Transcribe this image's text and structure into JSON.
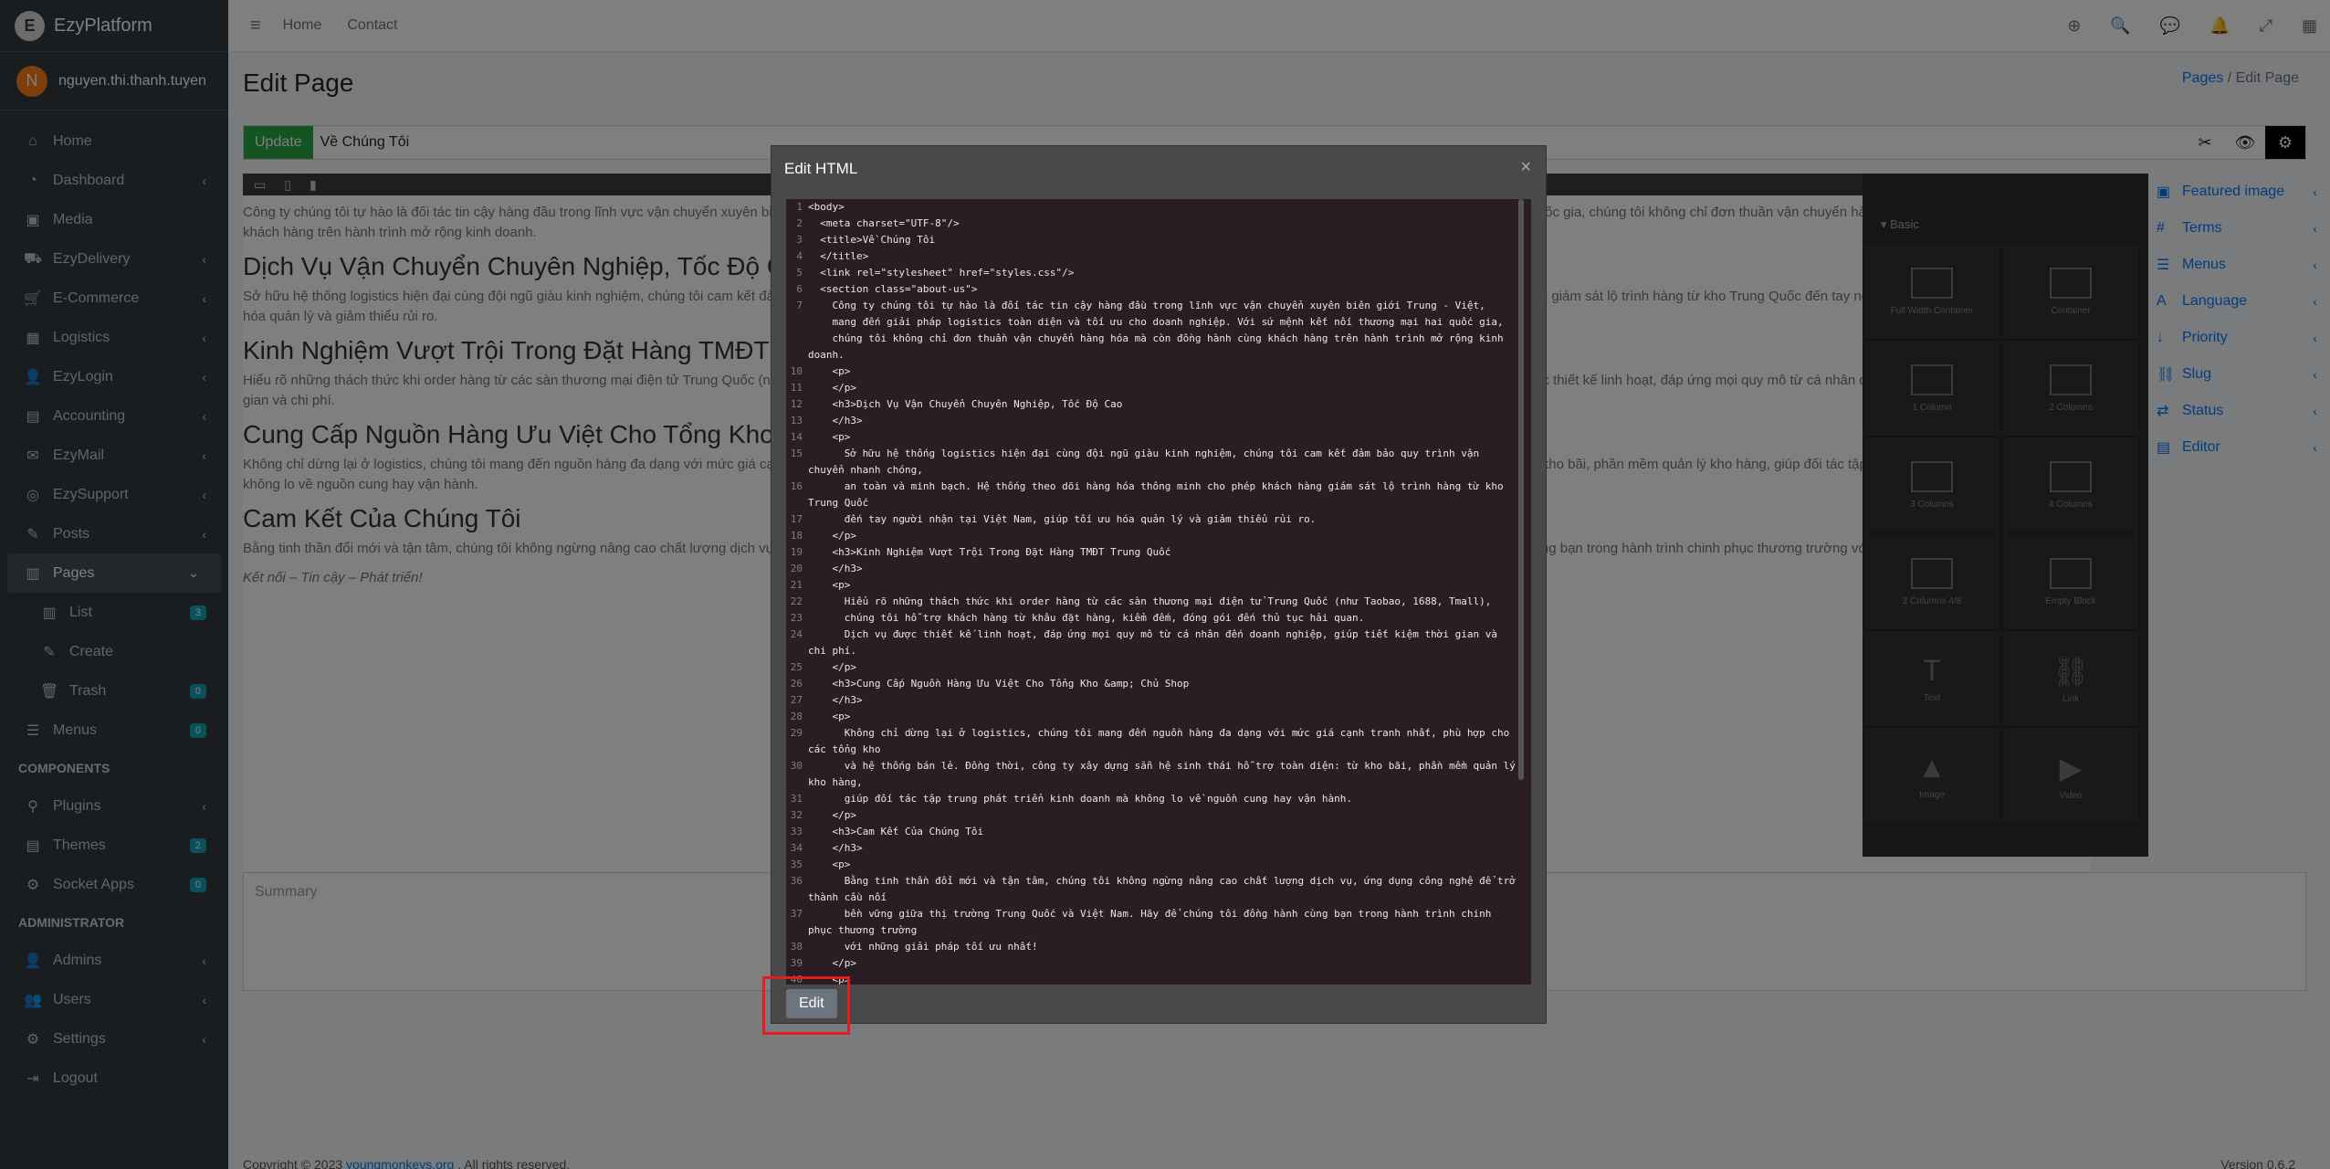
{
  "app": {
    "brand": "EzyPlatform",
    "brand_logo_letter": "E",
    "user_initial": "N",
    "user_name": "nguyen.thi.thanh.tuyen"
  },
  "sidebar": {
    "items": [
      {
        "label": "Home",
        "icon": "home-icon",
        "glyph": "⌂"
      },
      {
        "label": "Dashboard",
        "icon": "dashboard-icon",
        "glyph": "◔",
        "chev": "‹"
      },
      {
        "label": "Media",
        "icon": "media-icon",
        "glyph": "▣"
      },
      {
        "label": "EzyDelivery",
        "icon": "truck-icon",
        "glyph": "⛟",
        "chev": "‹"
      },
      {
        "label": "E-Commerce",
        "icon": "cart-icon",
        "glyph": "🛒",
        "chev": "‹"
      },
      {
        "label": "Logistics",
        "icon": "logistics-icon",
        "glyph": "▦",
        "chev": "‹"
      },
      {
        "label": "EzyLogin",
        "icon": "login-icon",
        "glyph": "👤",
        "chev": "‹"
      },
      {
        "label": "Accounting",
        "icon": "accounting-icon",
        "glyph": "▤",
        "chev": "‹"
      },
      {
        "label": "EzyMail",
        "icon": "mail-icon",
        "glyph": "✉",
        "chev": "‹"
      },
      {
        "label": "EzySupport",
        "icon": "support-icon",
        "glyph": "◎",
        "chev": "‹"
      },
      {
        "label": "Posts",
        "icon": "posts-icon",
        "glyph": "✎",
        "chev": "‹"
      },
      {
        "label": "Pages",
        "icon": "pages-icon",
        "glyph": "▥",
        "chev": "⌄"
      },
      {
        "label": "List",
        "icon": "list-icon",
        "glyph": "▥",
        "badge": "3"
      },
      {
        "label": "Create",
        "icon": "create-icon",
        "glyph": "✎"
      },
      {
        "label": "Trash",
        "icon": "trash-icon",
        "glyph": "🗑",
        "badge": "0"
      },
      {
        "label": "Menus",
        "icon": "menus-icon",
        "glyph": "☰",
        "badge": "0"
      }
    ],
    "components_header": "COMPONENTS",
    "components": [
      {
        "label": "Plugins",
        "icon": "plugins-icon",
        "glyph": "⚲",
        "chev": "‹"
      },
      {
        "label": "Themes",
        "icon": "themes-icon",
        "glyph": "▤",
        "badge": "2"
      },
      {
        "label": "Socket Apps",
        "icon": "socket-icon",
        "glyph": "⚙",
        "badge": "0"
      }
    ],
    "admin_header": "ADMINISTRATOR",
    "admin": [
      {
        "label": "Admins",
        "icon": "admins-icon",
        "glyph": "👤",
        "chev": "‹"
      },
      {
        "label": "Users",
        "icon": "users-icon",
        "glyph": "👥",
        "chev": "‹"
      },
      {
        "label": "Settings",
        "icon": "settings-icon",
        "glyph": "⚙",
        "chev": "‹"
      },
      {
        "label": "Logout",
        "icon": "logout-icon",
        "glyph": "⇥"
      }
    ]
  },
  "topbar": {
    "burger": "≡",
    "home": "Home",
    "contact": "Contact",
    "icons": [
      "⊕",
      "🔍",
      "💬",
      "🔔",
      "⤢",
      "▦"
    ]
  },
  "page": {
    "title": "Edit Page",
    "breadcrumb_pages": "Pages",
    "breadcrumb_sep": "/",
    "breadcrumb_current": "Edit Page",
    "update_label": "Update",
    "page_title_value": "Về Chúng Tôi",
    "summary_placeholder": "Summary",
    "footer_prefix": "Copyright © 2023",
    "footer_link": "youngmonkeys.org",
    "footer_suffix": ". All rights reserved.",
    "version": "Version 0.6.2"
  },
  "canvas": {
    "p1": "Công ty chúng tôi tự hào là đối tác tin cậy hàng đầu trong lĩnh vực vận chuyển xuyên biên giới Trung - Việt, mang đến giải pháp logistics toàn diện và tối ưu cho doanh nghiệp. Với sứ mệnh kết nối thương mại hai quốc gia, chúng tôi không chỉ đơn thuần vận chuyển hàng hóa mà còn đồng hành cùng khách hàng trên hành trình mở rộng kinh doanh.",
    "h1": "Dịch Vụ Vận Chuyển Chuyên Nghiệp, Tốc Độ Cao",
    "p2": "Sở hữu hệ thống logistics hiện đại cùng đội ngũ giàu kinh nghiệm, chúng tôi cam kết đảm bảo quy trình vận chuyển nhanh chóng, an toàn và minh bạch. Hệ thống theo dõi hàng hóa thông minh cho phép khách hàng giám sát lộ trình hàng từ kho Trung Quốc đến tay người nhận tại Việt Nam, giúp tối ưu hóa quản lý và giảm thiểu rủi ro.",
    "h2": "Kinh Nghiệm Vượt Trội Trong Đặt Hàng TMĐT Trung Quốc",
    "p3": "Hiểu rõ những thách thức khi order hàng từ các sàn thương mại điện tử Trung Quốc (như Taobao, 1688, Tmall), chúng tôi hỗ trợ khách hàng từ khâu đặt hàng, kiểm đếm, đóng gói đến thủ tục hải quan. Dịch vụ được thiết kế linh hoạt, đáp ứng mọi quy mô từ cá nhân đến doanh nghiệp, giúp tiết kiệm thời gian và chi phí.",
    "h3": "Cung Cấp Nguồn Hàng Ưu Việt Cho Tổng Kho & Chủ Shop",
    "p4": "Không chỉ dừng lại ở logistics, chúng tôi mang đến nguồn hàng đa dạng với mức giá cạnh tranh nhất, phù hợp cho các tổng kho và hệ thống bán lẻ. Đồng thời, công ty xây dựng sẵn hệ sinh thái hỗ trợ toàn diện: từ kho bãi, phần mềm quản lý kho hàng, giúp đối tác tập trung phát triển kinh doanh mà không lo về nguồn cung hay vận hành.",
    "h4": "Cam Kết Của Chúng Tôi",
    "p5": "Bằng tinh thần đổi mới và tận tâm, chúng tôi không ngừng nâng cao chất lượng dịch vụ, ứng dụng công nghệ để trở thành cầu nối bền vững giữa thị trường Trung Quốc và Việt Nam. Hãy để chúng tôi đồng hành cùng bạn trong hành trình chinh phục thương trường với những giải pháp tối ưu nhất!",
    "tagline": "Kết nối – Tin cậy – Phát triển!"
  },
  "blocks": {
    "section": "Basic",
    "items": [
      {
        "label": "Full Width Container",
        "kind": "box"
      },
      {
        "label": "Container",
        "kind": "box"
      },
      {
        "label": "1 Column",
        "kind": "box"
      },
      {
        "label": "2 Columns",
        "kind": "box"
      },
      {
        "label": "3 Columns",
        "kind": "box"
      },
      {
        "label": "4 Columns",
        "kind": "box"
      },
      {
        "label": "2 Columns 4/8",
        "kind": "box"
      },
      {
        "label": "Empty Block",
        "kind": "box"
      },
      {
        "label": "Text",
        "kind": "glyph",
        "glyph": "T"
      },
      {
        "label": "Link",
        "kind": "glyph",
        "glyph": "⛓"
      },
      {
        "label": "Image",
        "kind": "glyph",
        "glyph": "▲"
      },
      {
        "label": "Video",
        "kind": "glyph",
        "glyph": "▶"
      }
    ]
  },
  "props": [
    {
      "label": "Featured image",
      "glyph": "▣"
    },
    {
      "label": "Terms",
      "glyph": "#"
    },
    {
      "label": "Menus",
      "glyph": "☰"
    },
    {
      "label": "Language",
      "glyph": "A"
    },
    {
      "label": "Priority",
      "glyph": "↓"
    },
    {
      "label": "Slug",
      "glyph": "⛓"
    },
    {
      "label": "Status",
      "glyph": "⇄"
    },
    {
      "label": "Editor",
      "glyph": "▤"
    }
  ],
  "modal": {
    "title": "Edit HTML",
    "close": "×",
    "edit_label": "Edit",
    "code_lines": [
      [
        "1",
        "<body>"
      ],
      [
        "2",
        "  <meta charset=\"UTF-8\"/>"
      ],
      [
        "3",
        "  <title>Về Chúng Tôi"
      ],
      [
        "4",
        "  </title>"
      ],
      [
        "5",
        "  <link rel=\"stylesheet\" href=\"styles.css\"/>"
      ],
      [
        "6",
        "  <section class=\"about-us\">"
      ],
      [
        "7",
        "    Công ty chúng tôi tự hào là đối tác tin cậy hàng đầu trong lĩnh vực vận chuyển xuyên biên giới Trung - Việt,\n    mang đến giải pháp logistics toàn diện và tối ưu cho doanh nghiệp. Với sứ mệnh kết nối thương mại hai quốc gia,\n    chúng tôi không chỉ đơn thuần vận chuyển hàng hóa mà còn đồng hành cùng khách hàng trên hành trình mở rộng kinh\ndoanh."
      ],
      [
        "10",
        "    <p>"
      ],
      [
        "11",
        "    </p>"
      ],
      [
        "12",
        "    <h3>Dịch Vụ Vận Chuyển Chuyên Nghiệp, Tốc Độ Cao"
      ],
      [
        "13",
        "    </h3>"
      ],
      [
        "14",
        "    <p>"
      ],
      [
        "15",
        "      Sở hữu hệ thống logistics hiện đại cùng đội ngũ giàu kinh nghiệm, chúng tôi cam kết đảm bảo quy trình vận\nchuyển nhanh chóng,"
      ],
      [
        "16",
        "      an toàn và minh bạch. Hệ thống theo dõi hàng hóa thông minh cho phép khách hàng giám sát lộ trình hàng từ kho\nTrung Quốc"
      ],
      [
        "17",
        "      đến tay người nhận tại Việt Nam, giúp tối ưu hóa quản lý và giảm thiểu rủi ro."
      ],
      [
        "18",
        "    </p>"
      ],
      [
        "19",
        "    <h3>Kinh Nghiệm Vượt Trội Trong Đặt Hàng TMĐT Trung Quốc"
      ],
      [
        "20",
        "    </h3>"
      ],
      [
        "21",
        "    <p>"
      ],
      [
        "22",
        "      Hiểu rõ những thách thức khi order hàng từ các sàn thương mại điện tử Trung Quốc (như Taobao, 1688, Tmall),"
      ],
      [
        "23",
        "      chúng tôi hỗ trợ khách hàng từ khâu đặt hàng, kiểm đếm, đóng gói đến thủ tục hải quan."
      ],
      [
        "24",
        "      Dịch vụ được thiết kế linh hoạt, đáp ứng mọi quy mô từ cá nhân đến doanh nghiệp, giúp tiết kiệm thời gian và\nchi phí."
      ],
      [
        "25",
        "    </p>"
      ],
      [
        "26",
        "    <h3>Cung Cấp Nguồn Hàng Ưu Việt Cho Tổng Kho &amp; Chủ Shop"
      ],
      [
        "27",
        "    </h3>"
      ],
      [
        "28",
        "    <p>"
      ],
      [
        "29",
        "      Không chỉ dừng lại ở logistics, chúng tôi mang đến nguồn hàng đa dạng với mức giá cạnh tranh nhất, phù hợp cho\ncác tổng kho"
      ],
      [
        "30",
        "      và hệ thống bán lẻ. Đồng thời, công ty xây dựng sẵn hệ sinh thái hỗ trợ toàn diện: từ kho bãi, phần mềm quản lý\nkho hàng,"
      ],
      [
        "31",
        "      giúp đối tác tập trung phát triển kinh doanh mà không lo về nguồn cung hay vận hành."
      ],
      [
        "32",
        "    </p>"
      ],
      [
        "33",
        "    <h3>Cam Kết Của Chúng Tôi"
      ],
      [
        "34",
        "    </h3>"
      ],
      [
        "35",
        "    <p>"
      ],
      [
        "36",
        "      Bằng tinh thần đổi mới và tận tâm, chúng tôi không ngừng nâng cao chất lượng dịch vụ, ứng dụng công nghệ để trở\nthành cầu nối"
      ],
      [
        "37",
        "      bền vững giữa thị trường Trung Quốc và Việt Nam. Hãy để chúng tôi đồng hành cùng bạn trong hành trình chinh\nphục thương trường"
      ],
      [
        "38",
        "      với những giải pháp tối ưu nhất!"
      ],
      [
        "39",
        "    </p>"
      ],
      [
        "40",
        "    <p>"
      ]
    ]
  },
  "colors": {
    "sidebar_bg": "#343a40",
    "accent": "#007bff",
    "update_btn": "#28a745",
    "code_bg": "#2b1d24",
    "highlight": "#e31b23"
  }
}
